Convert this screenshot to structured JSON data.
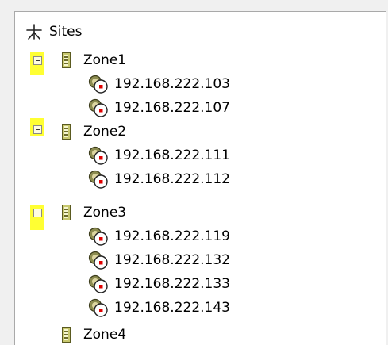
{
  "tree": {
    "root": {
      "label": "Sites",
      "icon": "sites-network-icon"
    },
    "zones": [
      {
        "label": "Zone1",
        "expanded": true,
        "hosts": [
          "192.168.222.103",
          "192.168.222.107"
        ]
      },
      {
        "label": "Zone2",
        "expanded": true,
        "hosts": [
          "192.168.222.111",
          "192.168.222.112"
        ]
      },
      {
        "label": "Zone3",
        "expanded": true,
        "hosts": [
          "192.168.222.119",
          "192.168.222.132",
          "192.168.222.133",
          "192.168.222.143"
        ]
      },
      {
        "label": "Zone4",
        "expanded": false,
        "hosts": []
      }
    ]
  },
  "colors": {
    "highlight": "#ffff33",
    "panel_bg": "#ffffff",
    "window_bg": "#f0f0f0",
    "status_dot": "#e00000"
  }
}
